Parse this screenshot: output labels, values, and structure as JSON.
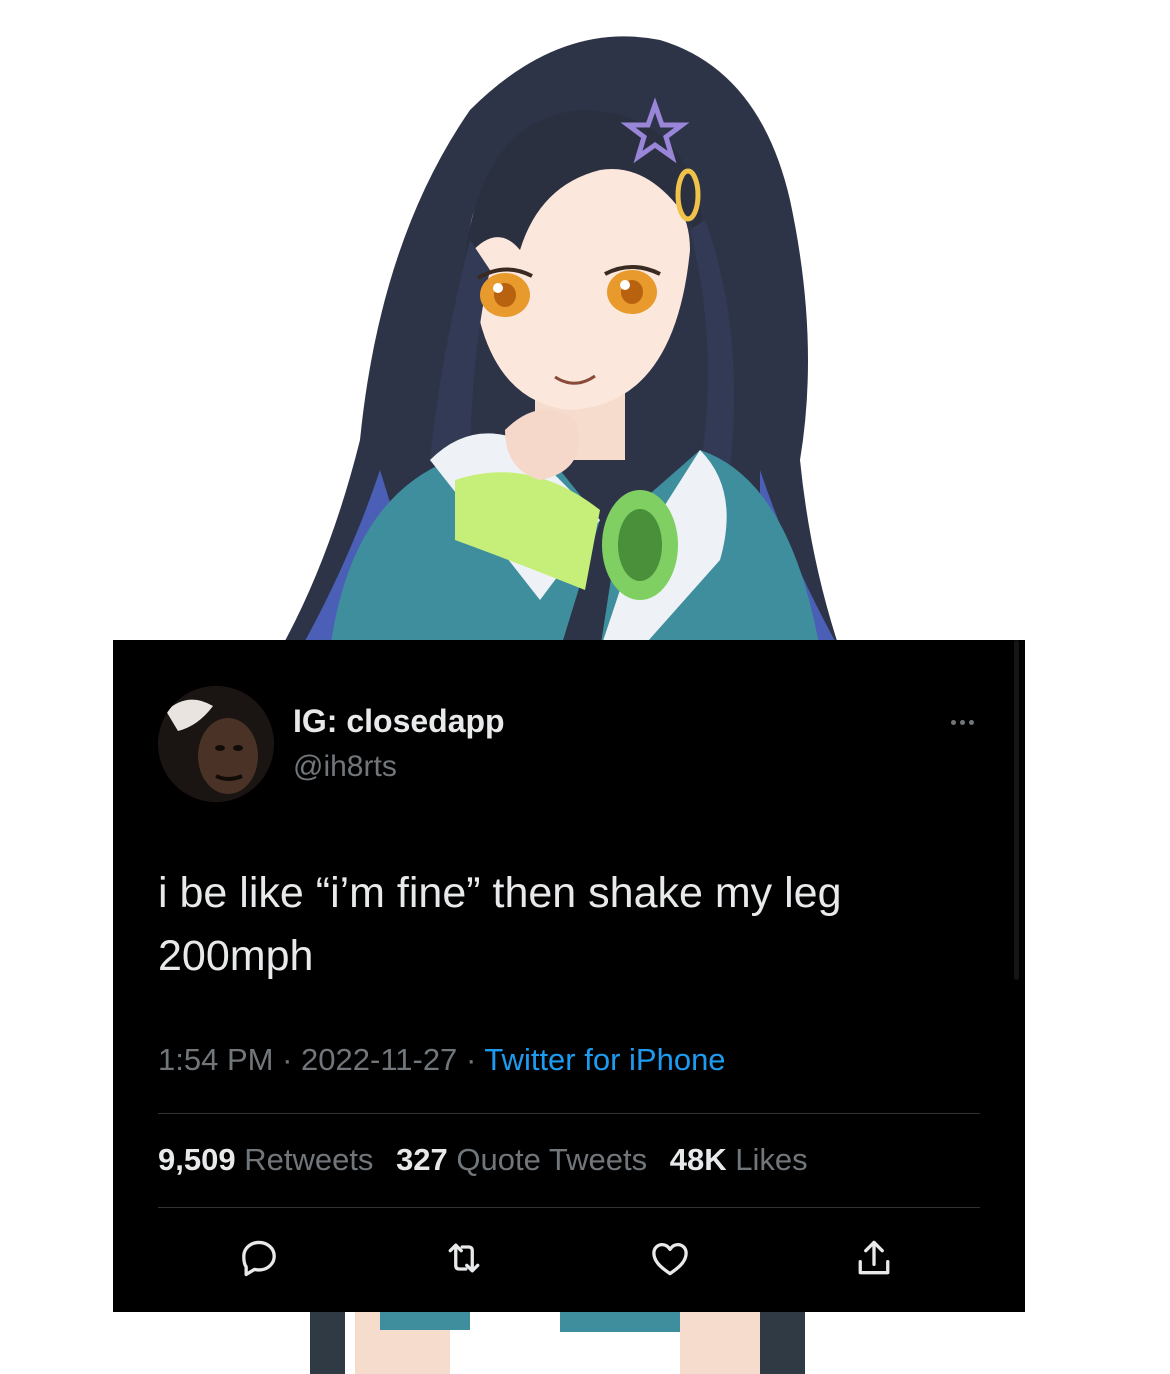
{
  "tweet": {
    "display_name": "IG: closedapp",
    "handle": "@ih8rts",
    "text": "i be like “i’m fine” then shake my leg 200mph",
    "time": "1:54 PM",
    "separator": "·",
    "date": "2022-11-27",
    "source": "Twitter for iPhone",
    "stats": {
      "retweets_count": "9,509",
      "retweets_label": "Retweets",
      "quotes_count": "327",
      "quotes_label": "Quote Tweets",
      "likes_count": "48K",
      "likes_label": "Likes"
    },
    "actions": [
      "reply-icon",
      "retweet-icon",
      "like-icon",
      "share-icon"
    ]
  },
  "colors": {
    "card_background": "#000000",
    "primary_text": "#e7e9ea",
    "secondary_text": "#71767b",
    "link": "#1d9bf0",
    "divider": "#2f3336"
  }
}
